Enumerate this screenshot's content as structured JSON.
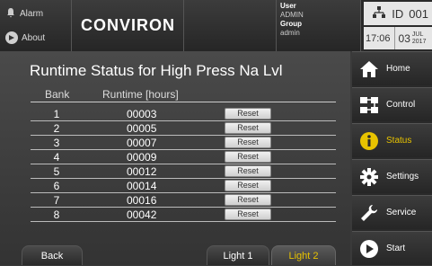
{
  "topbar": {
    "alarm_label": "Alarm",
    "about_label": "About",
    "logo": "CONVIRON",
    "user_label": "User",
    "user_value": "ADMIN",
    "group_label": "Group",
    "group_value": "admin",
    "id_label": "ID",
    "id_value": "001",
    "time": "17:06",
    "day": "03",
    "month": "JUL",
    "year": "2017"
  },
  "main": {
    "title": "Runtime Status for High Press Na Lvl",
    "col_bank": "Bank",
    "col_runtime": "Runtime [hours]",
    "reset_label": "Reset",
    "rows": [
      {
        "bank": "1",
        "hours": "00003"
      },
      {
        "bank": "2",
        "hours": "00005"
      },
      {
        "bank": "3",
        "hours": "00007"
      },
      {
        "bank": "4",
        "hours": "00009"
      },
      {
        "bank": "5",
        "hours": "00012"
      },
      {
        "bank": "6",
        "hours": "00014"
      },
      {
        "bank": "7",
        "hours": "00016"
      },
      {
        "bank": "8",
        "hours": "00042"
      }
    ]
  },
  "footer": {
    "back_label": "Back",
    "light1_label": "Light 1",
    "light2_label": "Light 2"
  },
  "sidebar": {
    "items": [
      {
        "label": "Home",
        "icon": "home-icon"
      },
      {
        "label": "Control",
        "icon": "control-icon"
      },
      {
        "label": "Status",
        "icon": "info-icon"
      },
      {
        "label": "Settings",
        "icon": "gear-icon"
      },
      {
        "label": "Service",
        "icon": "wrench-icon"
      },
      {
        "label": "Start",
        "icon": "play-icon"
      }
    ],
    "active": "Status"
  },
  "colors": {
    "accent": "#e8c300",
    "background": "#3a3a3a"
  }
}
